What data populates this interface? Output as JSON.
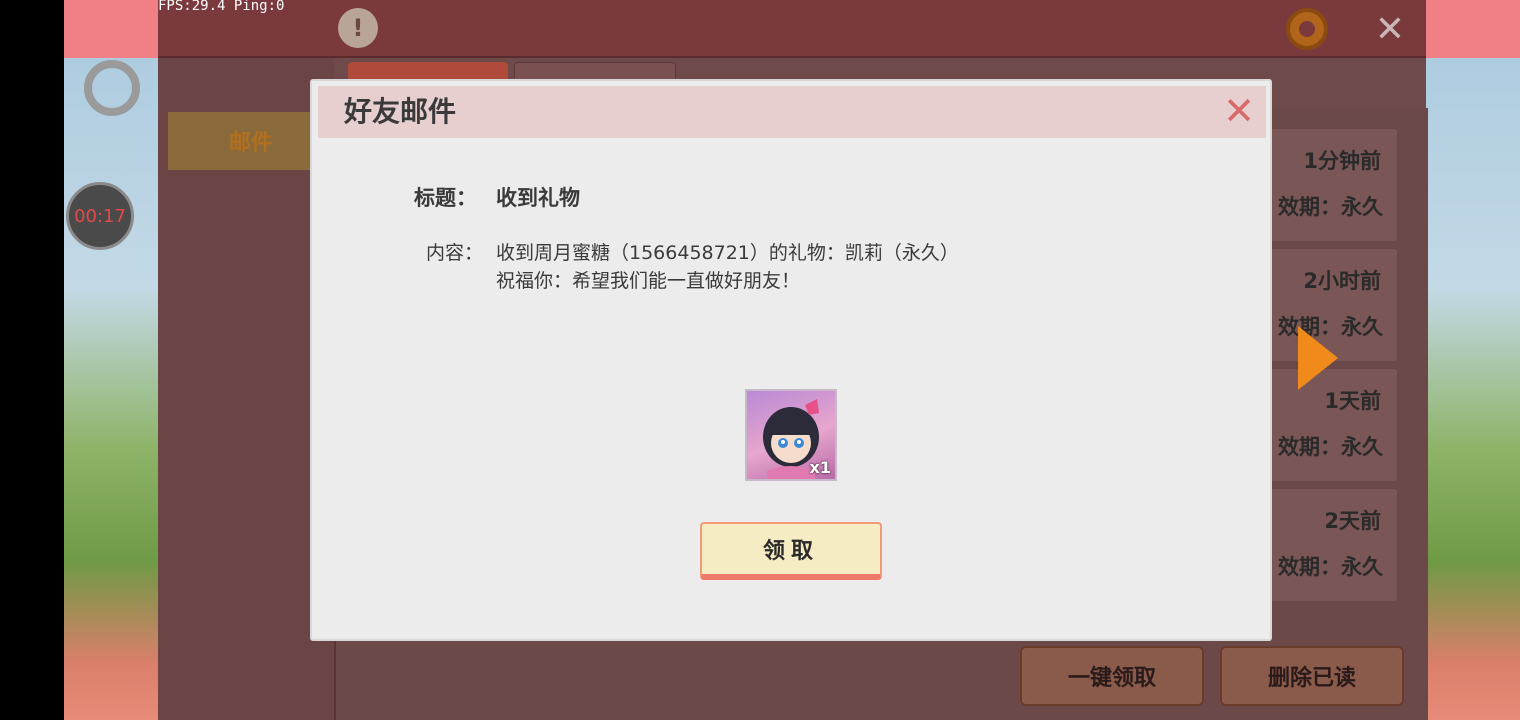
{
  "overlay": {
    "fps": "FPS:29.4  Ping:0",
    "timer": "00:17"
  },
  "background": {
    "tab_mail": "邮件"
  },
  "mail_list": [
    {
      "time": "1分钟前",
      "expire": "效期：永久"
    },
    {
      "time": "2小时前",
      "expire": "效期：永久"
    },
    {
      "time": "1天前",
      "expire": "效期：永久"
    },
    {
      "time": "2天前",
      "expire": "效期：永久"
    }
  ],
  "bottom_buttons": {
    "claim_all": "一键领取",
    "delete_read": "删除已读"
  },
  "dialog": {
    "title": "好友邮件",
    "subject_label": "标题：",
    "subject": "收到礼物",
    "content_label": "内容：",
    "content_line1": "收到周月蜜糖（1566458721）的礼物：凯莉（永久）",
    "content_line2": "祝福你：希望我们能一直做好朋友！",
    "gift_qty": "x1",
    "claim_label": "领取"
  },
  "icons": {
    "close": "close-icon",
    "settings": "gear-icon",
    "next": "arrow-right-icon"
  },
  "colors": {
    "dialog_header": "#e8cfcf",
    "claim_button": "#f6ecc3",
    "accent_orange": "#f08a1a"
  }
}
